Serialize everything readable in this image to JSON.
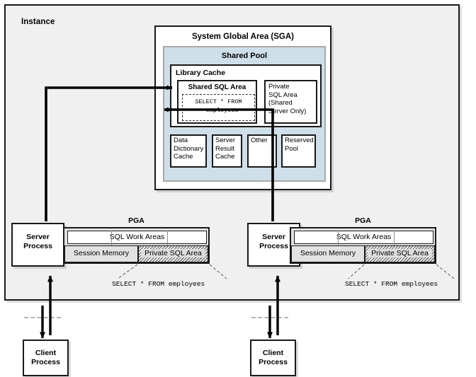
{
  "diagram": {
    "instance": {
      "label": "Instance"
    },
    "sga": {
      "title": "System Global Area (SGA)",
      "shared_pool": {
        "title": "Shared Pool",
        "library_cache": {
          "title": "Library Cache",
          "shared_sql_area": {
            "title": "Shared SQL Area",
            "sql_text": "SELECT * FROM\n  employees"
          },
          "private_sql_area": {
            "label": "Private\nSQL Area\n(Shared\nServer Only)"
          }
        },
        "components": [
          {
            "label": "Data\nDictionary\nCache"
          },
          {
            "label": "Server\nResult\nCache"
          },
          {
            "label": "Other"
          },
          {
            "label": "Reserved\nPool"
          }
        ]
      }
    },
    "server_sessions": [
      {
        "server_process_label": "Server\nProcess",
        "pga_title": "PGA",
        "sql_work_areas_label": "SQL Work Areas",
        "session_memory_label": "Session Memory",
        "private_sql_area_label": "Private SQL Area",
        "callout_text": "SELECT * FROM employees",
        "client_process_label": "Client\nProcess"
      },
      {
        "server_process_label": "Server\nProcess",
        "pga_title": "PGA",
        "sql_work_areas_label": "SQL Work Areas",
        "session_memory_label": "Session Memory",
        "private_sql_area_label": "Private SQL Area",
        "callout_text": "SELECT * FROM employees",
        "client_process_label": "Client\nProcess"
      }
    ],
    "colors": {
      "instance_fill": "#f0f0f0",
      "shared_pool_fill": "#cedfe9",
      "pga_fill": "#e2e2e2",
      "stroke": "#1a1a1a",
      "dashed_boundary": "#b4b4b4"
    }
  }
}
